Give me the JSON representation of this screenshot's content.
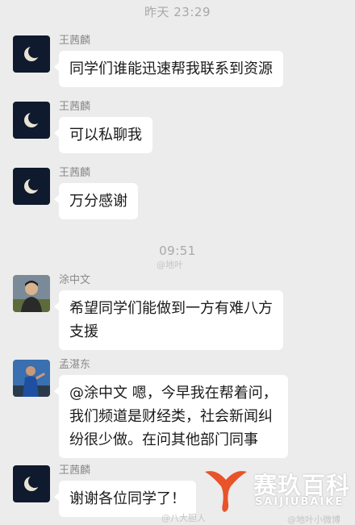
{
  "timestamps": [
    "昨天 23:29",
    "09:51"
  ],
  "messages": [
    {
      "sender": "王茜麟",
      "lines": [
        "同学们谁能迅速帮我联系到资源"
      ],
      "avatar": "moon"
    },
    {
      "sender": "王茜麟",
      "lines": [
        "可以私聊我"
      ],
      "avatar": "moon"
    },
    {
      "sender": "王茜麟",
      "lines": [
        "万分感谢"
      ],
      "avatar": "moon"
    },
    {
      "sender": "涂中文",
      "lines": [
        "希望同学们能做到一方有难八方",
        "支援"
      ],
      "avatar": "person-photo"
    },
    {
      "sender": "孟湛东",
      "lines": [
        "@涂中文 嗯，今早我在帮着问，",
        "我们频道是财经类，社会新闻纠",
        "纷很少做。在问其他部门同事"
      ],
      "avatar": "person-photo"
    },
    {
      "sender": "王茜麟",
      "lines": [
        "谢谢各位同学了！"
      ],
      "avatar": "moon"
    }
  ],
  "watermarks": {
    "mid": "@地叶",
    "bottom": "@八大胆人",
    "bottom_right": "@地叶小微博"
  },
  "brand": {
    "name": "赛玖百科",
    "pinyin": "SAIJIUBAIKE",
    "color": "#e8532a"
  },
  "colors": {
    "background": "#ececec",
    "bubble": "#ffffff",
    "text": "#1a1a1a",
    "secondary": "#8a8a8a"
  }
}
